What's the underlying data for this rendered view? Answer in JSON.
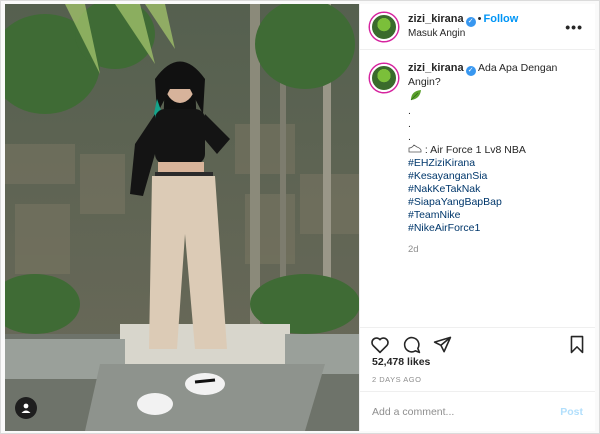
{
  "post": {
    "username": "zizi_kirana",
    "follow_label": "Follow",
    "location": "Masuk Angin",
    "more_label": "•••",
    "caption_first": "Ada Apa Dengan Angin?",
    "dots": [
      ".",
      ".",
      "."
    ],
    "shoe_line": ": Air Force 1 Lv8 NBA",
    "hashtags": [
      "#EHZiziKirana",
      "#KesayanganSia",
      "#NakKeTakNak",
      "#SiapaYangBapBap",
      "#TeamNike",
      "#NikeAirForce1"
    ],
    "age": "2d",
    "likes": "52,478 likes",
    "date": "2 DAYS AGO",
    "comment_placeholder": "Add a comment...",
    "post_label": "Post"
  },
  "icons": {
    "like": "heart-icon",
    "comment": "comment-icon",
    "share": "share-icon",
    "save": "bookmark-icon",
    "tag": "user-tag-icon"
  },
  "colors": {
    "accent": "#0095f6",
    "hashtag": "#00376b",
    "post_disabled": "#b2dffc"
  }
}
